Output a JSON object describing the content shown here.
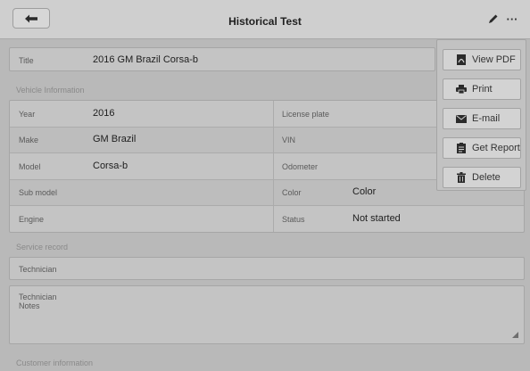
{
  "header": {
    "title": "Historical Test",
    "more_glyph": "···"
  },
  "title_row": {
    "label": "Title",
    "value": "2016 GM Brazil Corsa-b"
  },
  "vehicle_info": {
    "section_label": "Vehicle Information",
    "left": [
      {
        "label": "Year",
        "value": "2016"
      },
      {
        "label": "Make",
        "value": "GM Brazil"
      },
      {
        "label": "Model",
        "value": "Corsa-b"
      },
      {
        "label": "Sub model",
        "value": ""
      },
      {
        "label": "Engine",
        "value": ""
      }
    ],
    "right": [
      {
        "label": "License plate",
        "value": ""
      },
      {
        "label": "VIN",
        "value": ""
      },
      {
        "label": "Odometer",
        "value": ""
      },
      {
        "label": "Color",
        "value": "Color"
      },
      {
        "label": "Status",
        "value": "Not started"
      }
    ]
  },
  "service_record": {
    "section_label": "Service record",
    "technician_label": "Technician",
    "notes_label_line1": "Technician",
    "notes_label_line2": "Notes"
  },
  "customer_info": {
    "section_label": "Customer information"
  },
  "menu": {
    "items": [
      {
        "label": "View PDF",
        "icon": "pdf-icon"
      },
      {
        "label": "Print",
        "icon": "printer-icon"
      },
      {
        "label": "E-mail",
        "icon": "mail-icon"
      },
      {
        "label": "Get Report",
        "icon": "report-icon"
      },
      {
        "label": "Delete",
        "icon": "trash-icon"
      }
    ]
  }
}
